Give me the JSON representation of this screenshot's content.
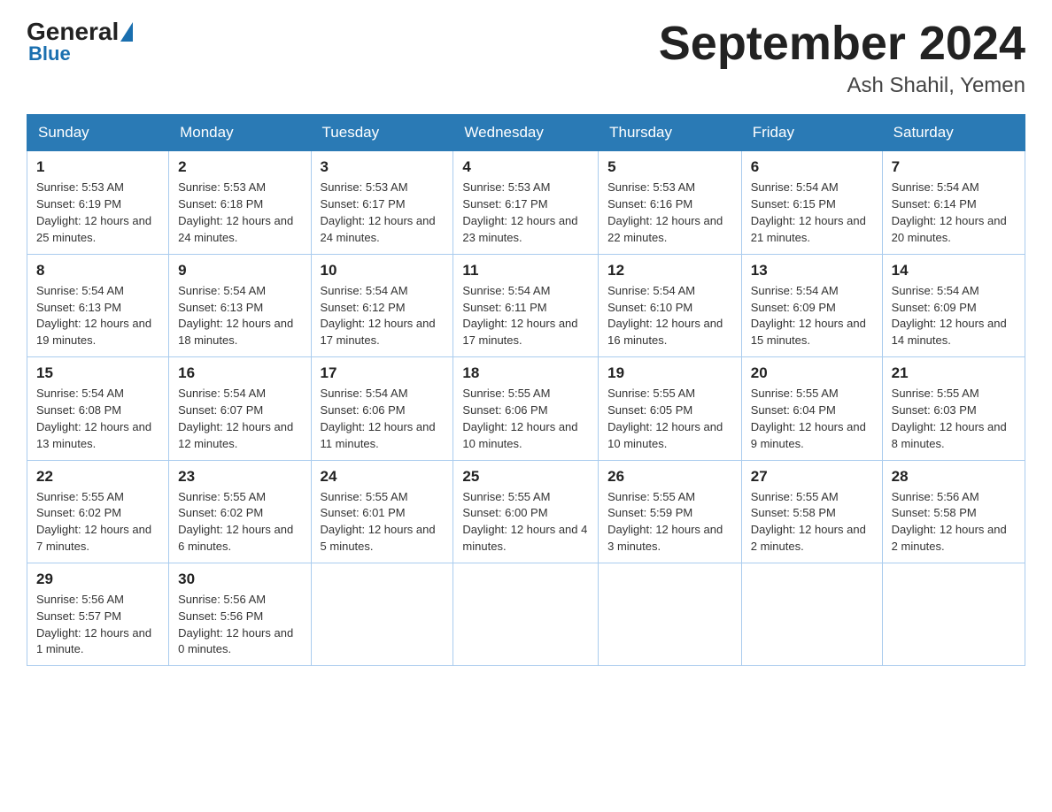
{
  "logo": {
    "general": "General",
    "blue": "Blue"
  },
  "title": "September 2024",
  "location": "Ash Shahil, Yemen",
  "days_of_week": [
    "Sunday",
    "Monday",
    "Tuesday",
    "Wednesday",
    "Thursday",
    "Friday",
    "Saturday"
  ],
  "weeks": [
    [
      {
        "day": "1",
        "sunrise": "5:53 AM",
        "sunset": "6:19 PM",
        "daylight": "12 hours and 25 minutes."
      },
      {
        "day": "2",
        "sunrise": "5:53 AM",
        "sunset": "6:18 PM",
        "daylight": "12 hours and 24 minutes."
      },
      {
        "day": "3",
        "sunrise": "5:53 AM",
        "sunset": "6:17 PM",
        "daylight": "12 hours and 24 minutes."
      },
      {
        "day": "4",
        "sunrise": "5:53 AM",
        "sunset": "6:17 PM",
        "daylight": "12 hours and 23 minutes."
      },
      {
        "day": "5",
        "sunrise": "5:53 AM",
        "sunset": "6:16 PM",
        "daylight": "12 hours and 22 minutes."
      },
      {
        "day": "6",
        "sunrise": "5:54 AM",
        "sunset": "6:15 PM",
        "daylight": "12 hours and 21 minutes."
      },
      {
        "day": "7",
        "sunrise": "5:54 AM",
        "sunset": "6:14 PM",
        "daylight": "12 hours and 20 minutes."
      }
    ],
    [
      {
        "day": "8",
        "sunrise": "5:54 AM",
        "sunset": "6:13 PM",
        "daylight": "12 hours and 19 minutes."
      },
      {
        "day": "9",
        "sunrise": "5:54 AM",
        "sunset": "6:13 PM",
        "daylight": "12 hours and 18 minutes."
      },
      {
        "day": "10",
        "sunrise": "5:54 AM",
        "sunset": "6:12 PM",
        "daylight": "12 hours and 17 minutes."
      },
      {
        "day": "11",
        "sunrise": "5:54 AM",
        "sunset": "6:11 PM",
        "daylight": "12 hours and 17 minutes."
      },
      {
        "day": "12",
        "sunrise": "5:54 AM",
        "sunset": "6:10 PM",
        "daylight": "12 hours and 16 minutes."
      },
      {
        "day": "13",
        "sunrise": "5:54 AM",
        "sunset": "6:09 PM",
        "daylight": "12 hours and 15 minutes."
      },
      {
        "day": "14",
        "sunrise": "5:54 AM",
        "sunset": "6:09 PM",
        "daylight": "12 hours and 14 minutes."
      }
    ],
    [
      {
        "day": "15",
        "sunrise": "5:54 AM",
        "sunset": "6:08 PM",
        "daylight": "12 hours and 13 minutes."
      },
      {
        "day": "16",
        "sunrise": "5:54 AM",
        "sunset": "6:07 PM",
        "daylight": "12 hours and 12 minutes."
      },
      {
        "day": "17",
        "sunrise": "5:54 AM",
        "sunset": "6:06 PM",
        "daylight": "12 hours and 11 minutes."
      },
      {
        "day": "18",
        "sunrise": "5:55 AM",
        "sunset": "6:06 PM",
        "daylight": "12 hours and 10 minutes."
      },
      {
        "day": "19",
        "sunrise": "5:55 AM",
        "sunset": "6:05 PM",
        "daylight": "12 hours and 10 minutes."
      },
      {
        "day": "20",
        "sunrise": "5:55 AM",
        "sunset": "6:04 PM",
        "daylight": "12 hours and 9 minutes."
      },
      {
        "day": "21",
        "sunrise": "5:55 AM",
        "sunset": "6:03 PM",
        "daylight": "12 hours and 8 minutes."
      }
    ],
    [
      {
        "day": "22",
        "sunrise": "5:55 AM",
        "sunset": "6:02 PM",
        "daylight": "12 hours and 7 minutes."
      },
      {
        "day": "23",
        "sunrise": "5:55 AM",
        "sunset": "6:02 PM",
        "daylight": "12 hours and 6 minutes."
      },
      {
        "day": "24",
        "sunrise": "5:55 AM",
        "sunset": "6:01 PM",
        "daylight": "12 hours and 5 minutes."
      },
      {
        "day": "25",
        "sunrise": "5:55 AM",
        "sunset": "6:00 PM",
        "daylight": "12 hours and 4 minutes."
      },
      {
        "day": "26",
        "sunrise": "5:55 AM",
        "sunset": "5:59 PM",
        "daylight": "12 hours and 3 minutes."
      },
      {
        "day": "27",
        "sunrise": "5:55 AM",
        "sunset": "5:58 PM",
        "daylight": "12 hours and 2 minutes."
      },
      {
        "day": "28",
        "sunrise": "5:56 AM",
        "sunset": "5:58 PM",
        "daylight": "12 hours and 2 minutes."
      }
    ],
    [
      {
        "day": "29",
        "sunrise": "5:56 AM",
        "sunset": "5:57 PM",
        "daylight": "12 hours and 1 minute."
      },
      {
        "day": "30",
        "sunrise": "5:56 AM",
        "sunset": "5:56 PM",
        "daylight": "12 hours and 0 minutes."
      },
      null,
      null,
      null,
      null,
      null
    ]
  ]
}
